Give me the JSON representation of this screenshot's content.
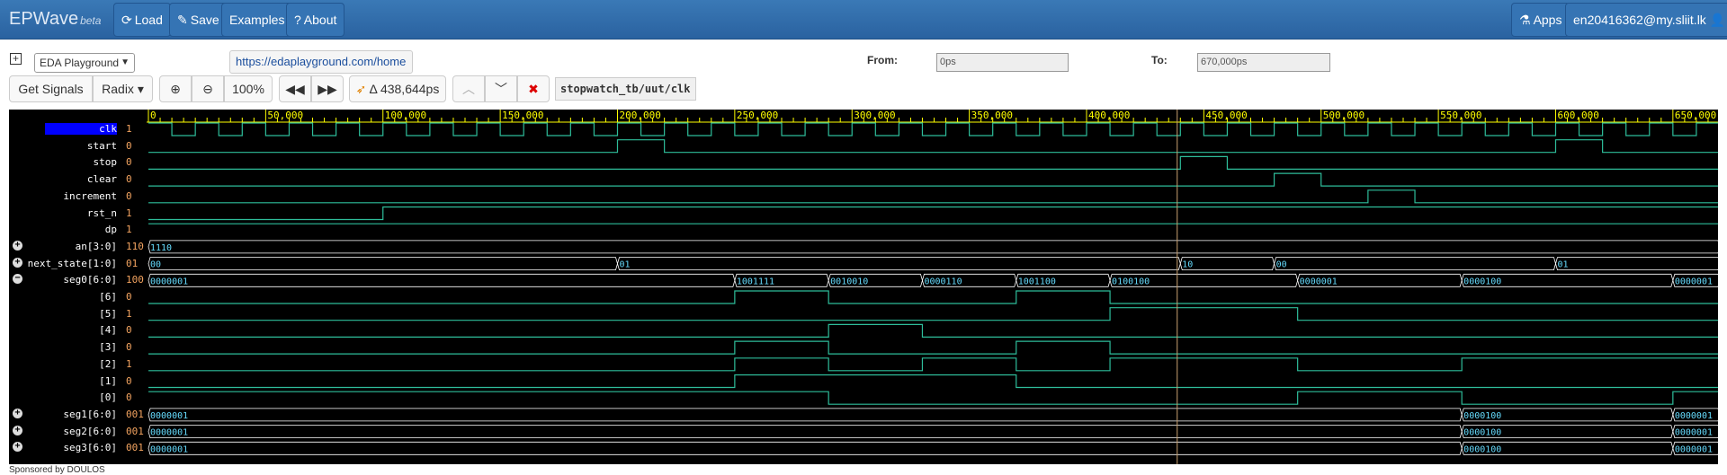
{
  "nav": {
    "brand": "EPWave",
    "brand_sub": "beta",
    "load": "Load",
    "save": "Save",
    "examples": "Examples",
    "about": "About",
    "apps": "Apps",
    "user": "en20416362@my.sliit.lk"
  },
  "toolbar1": {
    "playground": "EDA Playground",
    "url": "https://edaplayground.com/home",
    "from_label": "From:",
    "from_value": "0ps",
    "to_label": "To:",
    "to_value": "670,000ps"
  },
  "toolbar2": {
    "get_signals": "Get Signals",
    "radix": "Radix",
    "zoom": "100%",
    "delta": "Δ 438,644ps",
    "signal_path": "stopwatch_tb/uut/clk"
  },
  "icons": {
    "load": "refresh-icon",
    "save": "pencil-icon",
    "about": "question-icon",
    "apps": "flask-icon",
    "user": "user-icon"
  },
  "colors": {
    "nav": "#2f6ca9",
    "wave": "#2ebd9a",
    "grid": "#ffff00",
    "selected": "#0000ff",
    "value": "#f4a460",
    "cursor": "#c8a070"
  },
  "timescale": {
    "ticks": [
      "0",
      "50,000",
      "100,000",
      "150,000",
      "200,000",
      "250,000",
      "300,000",
      "350,000",
      "400,000",
      "450,000",
      "500,000",
      "550,000",
      "600,000",
      "650,000"
    ],
    "cursor_ps": 438644
  },
  "signals": [
    {
      "name": "clk",
      "value": "1",
      "expand": ""
    },
    {
      "name": "start",
      "value": "0",
      "expand": ""
    },
    {
      "name": "stop",
      "value": "0",
      "expand": ""
    },
    {
      "name": "clear",
      "value": "0",
      "expand": ""
    },
    {
      "name": "increment",
      "value": "0",
      "expand": ""
    },
    {
      "name": "rst_n",
      "value": "1",
      "expand": ""
    },
    {
      "name": "dp",
      "value": "1",
      "expand": ""
    },
    {
      "name": "an[3:0]",
      "value": "110",
      "expand": "+"
    },
    {
      "name": "next_state[1:0]",
      "value": "01",
      "expand": "+"
    },
    {
      "name": "seg0[6:0]",
      "value": "100",
      "expand": "−"
    },
    {
      "name": "[6]",
      "value": "0",
      "expand": ""
    },
    {
      "name": "[5]",
      "value": "1",
      "expand": ""
    },
    {
      "name": "[4]",
      "value": "0",
      "expand": ""
    },
    {
      "name": "[3]",
      "value": "0",
      "expand": ""
    },
    {
      "name": "[2]",
      "value": "1",
      "expand": ""
    },
    {
      "name": "[1]",
      "value": "0",
      "expand": ""
    },
    {
      "name": "[0]",
      "value": "0",
      "expand": ""
    },
    {
      "name": "seg1[6:0]",
      "value": "001",
      "expand": "+"
    },
    {
      "name": "seg2[6:0]",
      "value": "001",
      "expand": "+"
    },
    {
      "name": "seg3[6:0]",
      "value": "001",
      "expand": "+"
    }
  ],
  "waves": {
    "clk_period_ps": 20000,
    "start": [
      [
        0,
        0
      ],
      [
        200000,
        1
      ],
      [
        220000,
        0
      ],
      [
        600000,
        1
      ],
      [
        620000,
        0
      ]
    ],
    "stop": [
      [
        0,
        0
      ],
      [
        440000,
        1
      ],
      [
        460000,
        0
      ]
    ],
    "clear": [
      [
        0,
        0
      ],
      [
        480000,
        1
      ],
      [
        500000,
        0
      ]
    ],
    "increment": [
      [
        0,
        0
      ],
      [
        520000,
        1
      ],
      [
        540000,
        0
      ]
    ],
    "rst_n": [
      [
        0,
        0
      ],
      [
        100000,
        1
      ]
    ],
    "dp": [
      [
        0,
        1
      ]
    ],
    "an": [
      [
        0,
        "1110"
      ]
    ],
    "next_state": [
      [
        0,
        "00"
      ],
      [
        200000,
        "01"
      ],
      [
        440000,
        "10"
      ],
      [
        480000,
        "00"
      ],
      [
        600000,
        "01"
      ]
    ],
    "seg0": [
      [
        0,
        "0000001"
      ],
      [
        250000,
        "1001111"
      ],
      [
        290000,
        "0010010"
      ],
      [
        330000,
        "0000110"
      ],
      [
        370000,
        "1001100"
      ],
      [
        410000,
        "0100100"
      ],
      [
        490000,
        "0000001"
      ],
      [
        560000,
        "0000100"
      ],
      [
        650000,
        "0000001"
      ]
    ],
    "seg0_bits": {
      "6": [
        [
          0,
          0
        ],
        [
          250000,
          1
        ],
        [
          290000,
          0
        ],
        [
          370000,
          1
        ],
        [
          410000,
          0
        ]
      ],
      "5": [
        [
          0,
          0
        ],
        [
          410000,
          1
        ],
        [
          490000,
          0
        ]
      ],
      "4": [
        [
          0,
          0
        ],
        [
          290000,
          1
        ],
        [
          330000,
          0
        ]
      ],
      "3": [
        [
          0,
          0
        ],
        [
          250000,
          1
        ],
        [
          290000,
          0
        ],
        [
          370000,
          1
        ],
        [
          410000,
          0
        ]
      ],
      "2": [
        [
          0,
          0
        ],
        [
          250000,
          1
        ],
        [
          290000,
          0
        ],
        [
          330000,
          1
        ],
        [
          370000,
          0
        ],
        [
          410000,
          1
        ],
        [
          490000,
          0
        ],
        [
          560000,
          1
        ]
      ],
      "1": [
        [
          0,
          0
        ],
        [
          250000,
          1
        ],
        [
          370000,
          0
        ]
      ],
      "0": [
        [
          0,
          1
        ],
        [
          290000,
          0
        ],
        [
          490000,
          1
        ],
        [
          560000,
          0
        ],
        [
          650000,
          1
        ]
      ]
    },
    "seg1": [
      [
        0,
        "0000001"
      ],
      [
        560000,
        "0000100"
      ],
      [
        650000,
        "0000001"
      ]
    ],
    "seg2": [
      [
        0,
        "0000001"
      ],
      [
        560000,
        "0000100"
      ],
      [
        650000,
        "0000001"
      ]
    ],
    "seg3": [
      [
        0,
        "0000001"
      ],
      [
        560000,
        "0000100"
      ],
      [
        650000,
        "0000001"
      ]
    ]
  },
  "footer": "DOULOS"
}
